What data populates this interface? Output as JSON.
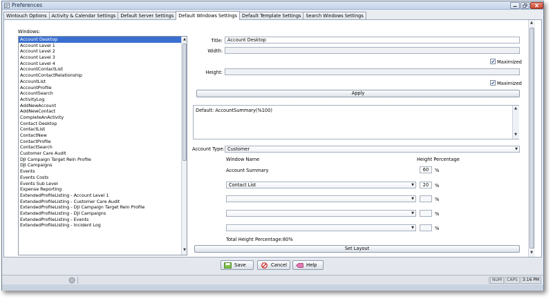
{
  "window": {
    "title": "Preferences",
    "icon": "preferences-icon"
  },
  "tabs": [
    {
      "label": "Wintouch Options"
    },
    {
      "label": "Activity & Calendar Settings"
    },
    {
      "label": "Default Server Settings"
    },
    {
      "label": "Default Windows Settings",
      "active": true
    },
    {
      "label": "Default Template Settings"
    },
    {
      "label": "Search Windows Settings"
    }
  ],
  "windows_list": {
    "label": "Windows:",
    "selected": "Account Desktop",
    "items": [
      "Account Desktop",
      "Account Level 1",
      "Account Level 2",
      "Account Level 3",
      "Account Level 4",
      "AccountContactList",
      "AccountContactRelationship",
      "AccountList",
      "AccountProfile",
      "AccountSearch",
      "ActivityLog",
      "AddNewAccount",
      "AddNewContact",
      "CompleteAnActivity",
      "Contact Desktop",
      "ContactList",
      "ContactNew",
      "ContactProfile",
      "ContactSearch",
      "Customer Care Audit",
      "DJI Campaign Target Reln Profile",
      "DJI Campaigns",
      "Events",
      "Events Costs",
      "Events Sub Level",
      "Expense Reporting",
      "ExtendedProfileListing - Account Level 1",
      "ExtendedProfileListing - Customer Care Audit",
      "ExtendedProfileListing - DJI Campaign Target Reln Profile",
      "ExtendedProfileListing - DJI Campaigns",
      "ExtendedProfileListing - Events",
      "ExtendedProfileListing - Incident Log"
    ]
  },
  "form": {
    "title_label": "Title:",
    "title_value": "Account Desktop",
    "width_label": "Width:",
    "width_value": "",
    "height_label": "Height:",
    "height_value": "",
    "maximized_label": "Maximized",
    "apply_label": "Apply",
    "default_text": "Default: AccountSummary(%100)",
    "account_type_label": "Account Type:",
    "account_type_value": "Customer",
    "col_window_name": "Window Name",
    "col_height_pct": "Height Percentage",
    "percent_sign": "%",
    "rows": [
      {
        "name": "Account Summary",
        "pct": "60",
        "dropdown": false
      },
      {
        "name": "Contact List",
        "pct": "20",
        "dropdown": true
      },
      {
        "name": "",
        "pct": "",
        "dropdown": true
      },
      {
        "name": "",
        "pct": "",
        "dropdown": true
      },
      {
        "name": "",
        "pct": "",
        "dropdown": true
      }
    ],
    "total_label": "Total Height Percentage:80%",
    "set_layout_label": "Set Layout"
  },
  "buttons": {
    "save": "Save",
    "cancel": "Cancel",
    "help": "Help"
  },
  "status": {
    "num": "NUM",
    "caps": "CAPS",
    "time": "3:16 PM"
  },
  "colors": {
    "selection": "#3a6fd0",
    "close_button": "#c7432c"
  }
}
